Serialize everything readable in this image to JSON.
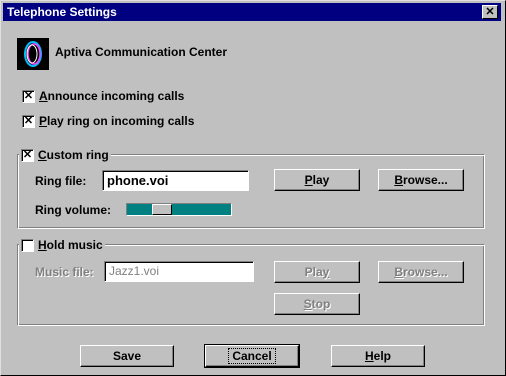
{
  "window": {
    "title": "Telephone Settings",
    "close_glyph": "✕"
  },
  "header": {
    "app_name": "Aptiva Communication Center",
    "logo_icon": "aptiva-logo-icon"
  },
  "options": {
    "announce_incoming": {
      "prefix": "A",
      "rest": "nnounce incoming calls",
      "checked": true
    },
    "play_ring": {
      "prefix": "P",
      "rest": "lay ring on incoming calls",
      "checked": true
    }
  },
  "custom_ring": {
    "prefix": "C",
    "rest": "ustom ring",
    "checked": true,
    "ring_file_label": "Ring file:",
    "ring_file_value": "phone.voi",
    "play_button": {
      "prefix": "P",
      "rest": "lay"
    },
    "browse_button": {
      "prefix": "B",
      "rest": "rowse..."
    },
    "ring_volume_label": "Ring volume:",
    "ring_volume_fraction": 0.3
  },
  "hold_music": {
    "prefix": "H",
    "rest": "old music",
    "checked": false,
    "music_file_label": "Music file:",
    "music_file_value": "Jazz1.voi",
    "play_button": {
      "prefix": "Pla",
      "underline": "y"
    },
    "browse_button": {
      "prefix": "B",
      "rest": "rowse..."
    },
    "stop_button": {
      "prefix": "S",
      "rest": "top"
    }
  },
  "footer": {
    "save_label": "Save",
    "cancel_label": "Cancel",
    "help_prefix": "H",
    "help_rest": "elp"
  },
  "colors": {
    "titlebar": "#000080",
    "slider_track": "#008080",
    "face": "#c0c0c0"
  }
}
